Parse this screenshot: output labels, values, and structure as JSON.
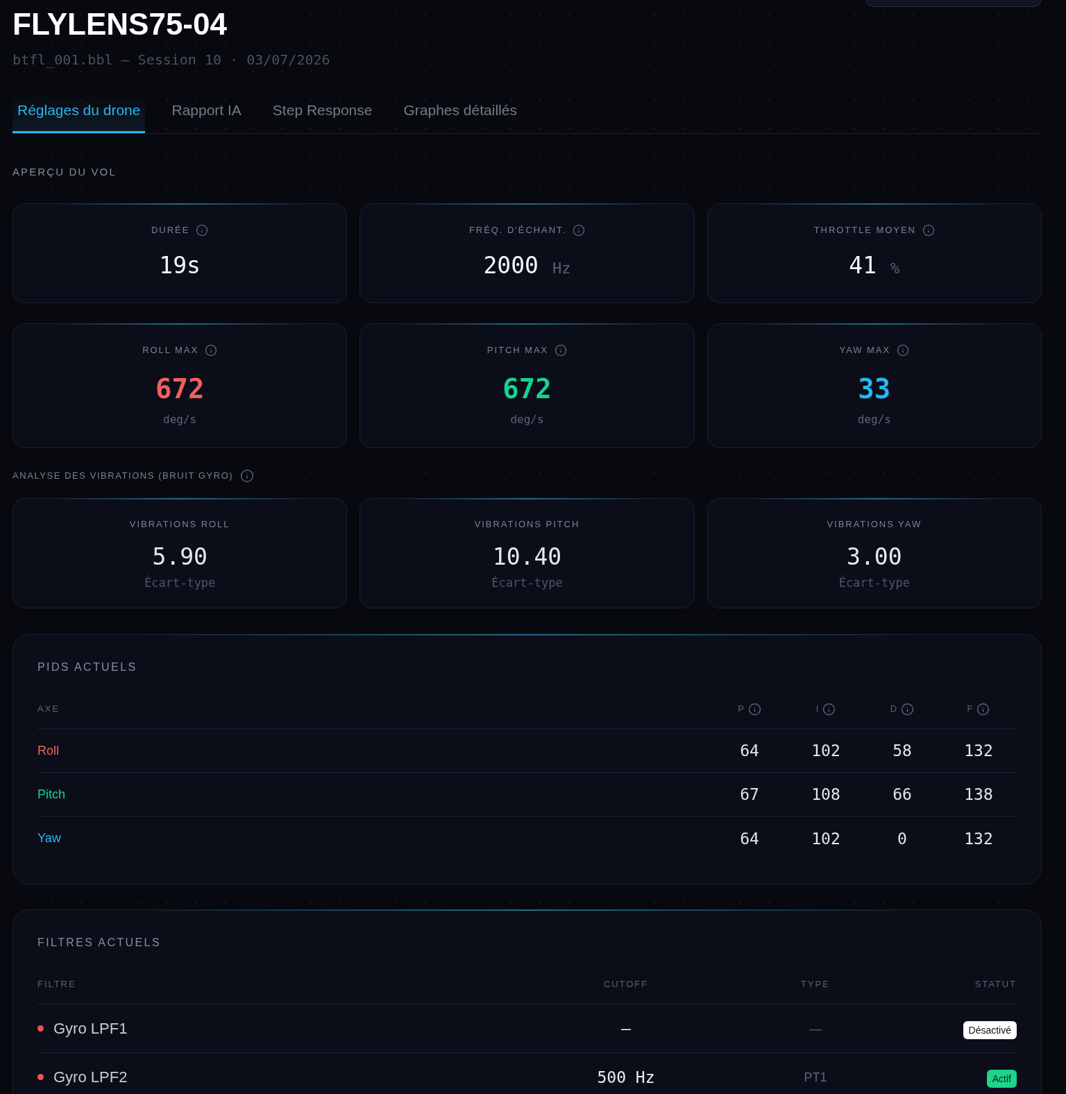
{
  "header": {
    "title": "FLYLENS75-04",
    "subtitle": "btfl_001.bbl — Session 10 · 03/07/2026"
  },
  "tabs": [
    {
      "label": "Réglages du drone",
      "selected": true
    },
    {
      "label": "Rapport IA",
      "selected": false
    },
    {
      "label": "Step Response",
      "selected": false
    },
    {
      "label": "Graphes détaillés",
      "selected": false
    }
  ],
  "flight_overview": {
    "title": "APERÇU DU VOL",
    "cards": [
      {
        "kind": "inline",
        "label": "DURÉE",
        "value": "19s"
      },
      {
        "kind": "inline",
        "label": "FRÉQ. D'ÉCHANT.",
        "value": "2000",
        "unit": "Hz"
      },
      {
        "kind": "inline",
        "label": "THROTTLE MOYEN",
        "value": "41",
        "unit": "%"
      },
      {
        "kind": "stacked",
        "label": "ROLL MAX",
        "value": "672",
        "unit": "deg/s",
        "color": "#f0605b"
      },
      {
        "kind": "stacked",
        "label": "PITCH MAX",
        "value": "672",
        "unit": "deg/s",
        "color": "#16d38f"
      },
      {
        "kind": "stacked",
        "label": "YAW MAX",
        "value": "33",
        "unit": "deg/s",
        "color": "#29b5f2"
      }
    ]
  },
  "vibrations": {
    "title": "ANALYSE DES VIBRATIONS (BRUIT GYRO)",
    "cards": [
      {
        "label": "VIBRATIONS ROLL",
        "value": "5.90",
        "note": "Écart-type"
      },
      {
        "label": "VIBRATIONS PITCH",
        "value": "10.40",
        "note": "Écart-type"
      },
      {
        "label": "VIBRATIONS YAW",
        "value": "3.00",
        "note": "Écart-type"
      }
    ]
  },
  "pids": {
    "title": "PIDS ACTUELS",
    "columns": [
      "AXE",
      "P",
      "I",
      "D",
      "F"
    ],
    "rows": [
      {
        "axis": "Roll",
        "color": "#f0605b",
        "values": [
          "64",
          "102",
          "58",
          "132"
        ]
      },
      {
        "axis": "Pitch",
        "color": "#16d38f",
        "values": [
          "67",
          "108",
          "66",
          "138"
        ]
      },
      {
        "axis": "Yaw",
        "color": "#29b5f2",
        "values": [
          "64",
          "102",
          "0",
          "132"
        ]
      }
    ]
  },
  "filters": {
    "title": "FILTRES ACTUELS",
    "columns": [
      "FILTRE",
      "CUTOFF",
      "TYPE",
      "STATUT"
    ],
    "rows": [
      {
        "name": "Gyro LPF1",
        "color": "#ef5350",
        "cutoff": "—",
        "type": "—",
        "status": "Désactivé",
        "active": false
      },
      {
        "name": "Gyro LPF2",
        "color": "#ef5350",
        "cutoff": "500 Hz",
        "type": "PT1",
        "status": "Actif",
        "active": true
      }
    ]
  }
}
